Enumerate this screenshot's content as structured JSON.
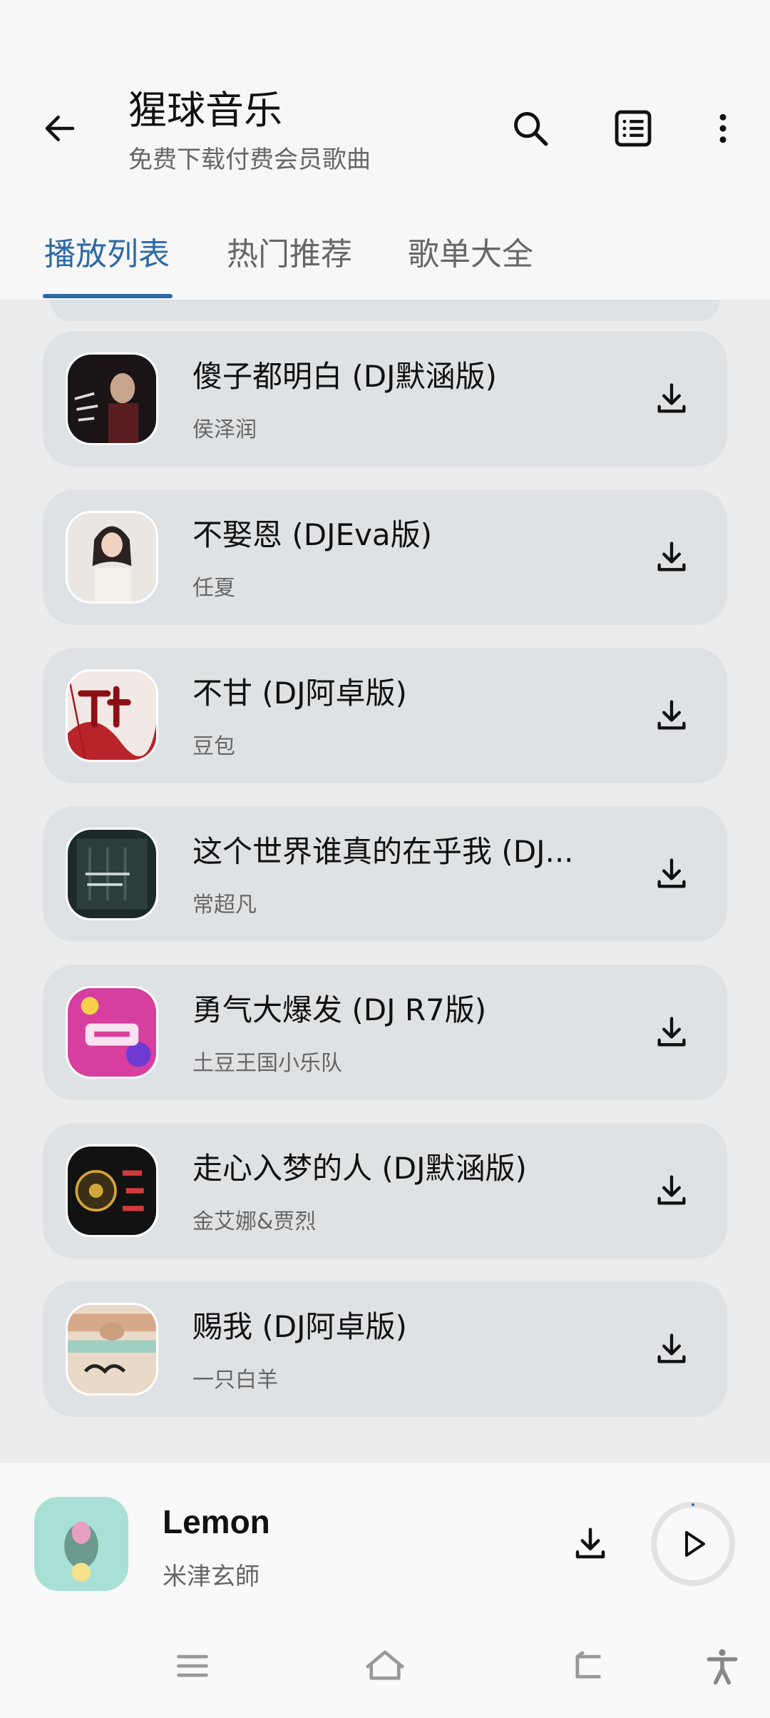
{
  "app": {
    "title": "猩球音乐",
    "subtitle": "免费下载付费会员歌曲",
    "accent_color": "#2c6aa7"
  },
  "header": {
    "back_icon": "arrow-left-icon",
    "search_icon": "search-icon",
    "list_icon": "list-icon",
    "more_icon": "more-vertical-icon"
  },
  "tabs": [
    {
      "label": "播放列表",
      "active": true
    },
    {
      "label": "热门推荐",
      "active": false
    },
    {
      "label": "歌单大全",
      "active": false
    }
  ],
  "songs": [
    {
      "title": "傻子都明白 (DJ默涵版)",
      "artist": "侯泽润",
      "download_icon": "download-icon"
    },
    {
      "title": "不娶恩 (DJEva版)",
      "artist": "任夏",
      "download_icon": "download-icon"
    },
    {
      "title": "不甘 (DJ阿卓版)",
      "artist": "豆包",
      "download_icon": "download-icon"
    },
    {
      "title": "这个世界谁真的在乎我 (DJ...",
      "artist": "常超凡",
      "download_icon": "download-icon"
    },
    {
      "title": "勇气大爆发 (DJ R7版)",
      "artist": "土豆王国小乐队",
      "download_icon": "download-icon"
    },
    {
      "title": "走心入梦的人 (DJ默涵版)",
      "artist": "金艾娜&贾烈",
      "download_icon": "download-icon"
    },
    {
      "title": "赐我 (DJ阿卓版)",
      "artist": "一只白羊",
      "download_icon": "download-icon"
    }
  ],
  "now_playing": {
    "title": "Lemon",
    "artist": "米津玄師",
    "download_icon": "download-icon",
    "play_icon": "play-icon",
    "progress": 0.0
  },
  "system_nav": {
    "menu_icon": "menu-icon",
    "home_icon": "home-icon",
    "back_icon": "back-icon",
    "accessibility_icon": "accessibility-icon"
  }
}
